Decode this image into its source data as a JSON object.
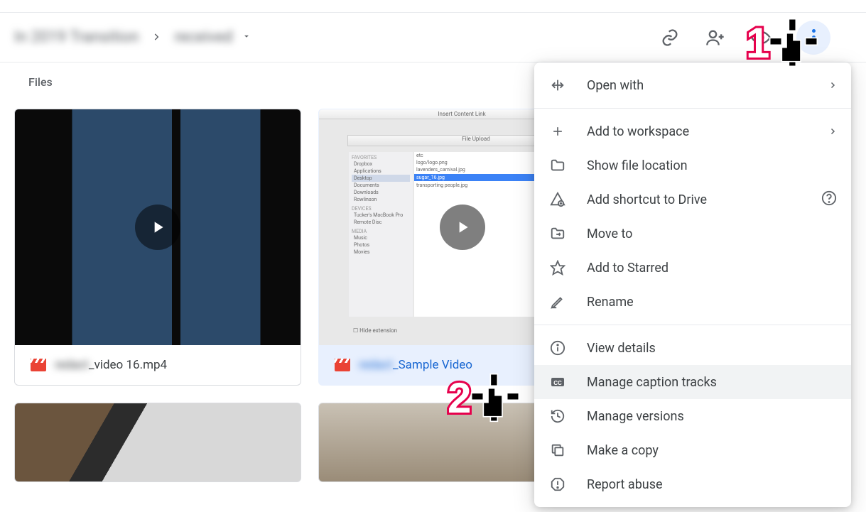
{
  "header": {
    "crumb1": "In 2019 Transition",
    "crumb2": "received"
  },
  "section": {
    "title": "Files"
  },
  "files": [
    {
      "name_hidden": "redact",
      "name_suffix": "_video 16.mp4"
    },
    {
      "name_hidden": "redact",
      "name_suffix": "_Sample Video"
    }
  ],
  "menu": {
    "open_with": "Open with",
    "add_workspace": "Add to workspace",
    "show_location": "Show file location",
    "add_shortcut": "Add shortcut to Drive",
    "move_to": "Move to",
    "add_starred": "Add to Starred",
    "rename": "Rename",
    "view_details": "View details",
    "manage_captions": "Manage caption tracks",
    "manage_versions": "Manage versions",
    "make_copy": "Make a copy",
    "report_abuse": "Report abuse"
  },
  "annotations": {
    "one": "1",
    "two": "2"
  }
}
